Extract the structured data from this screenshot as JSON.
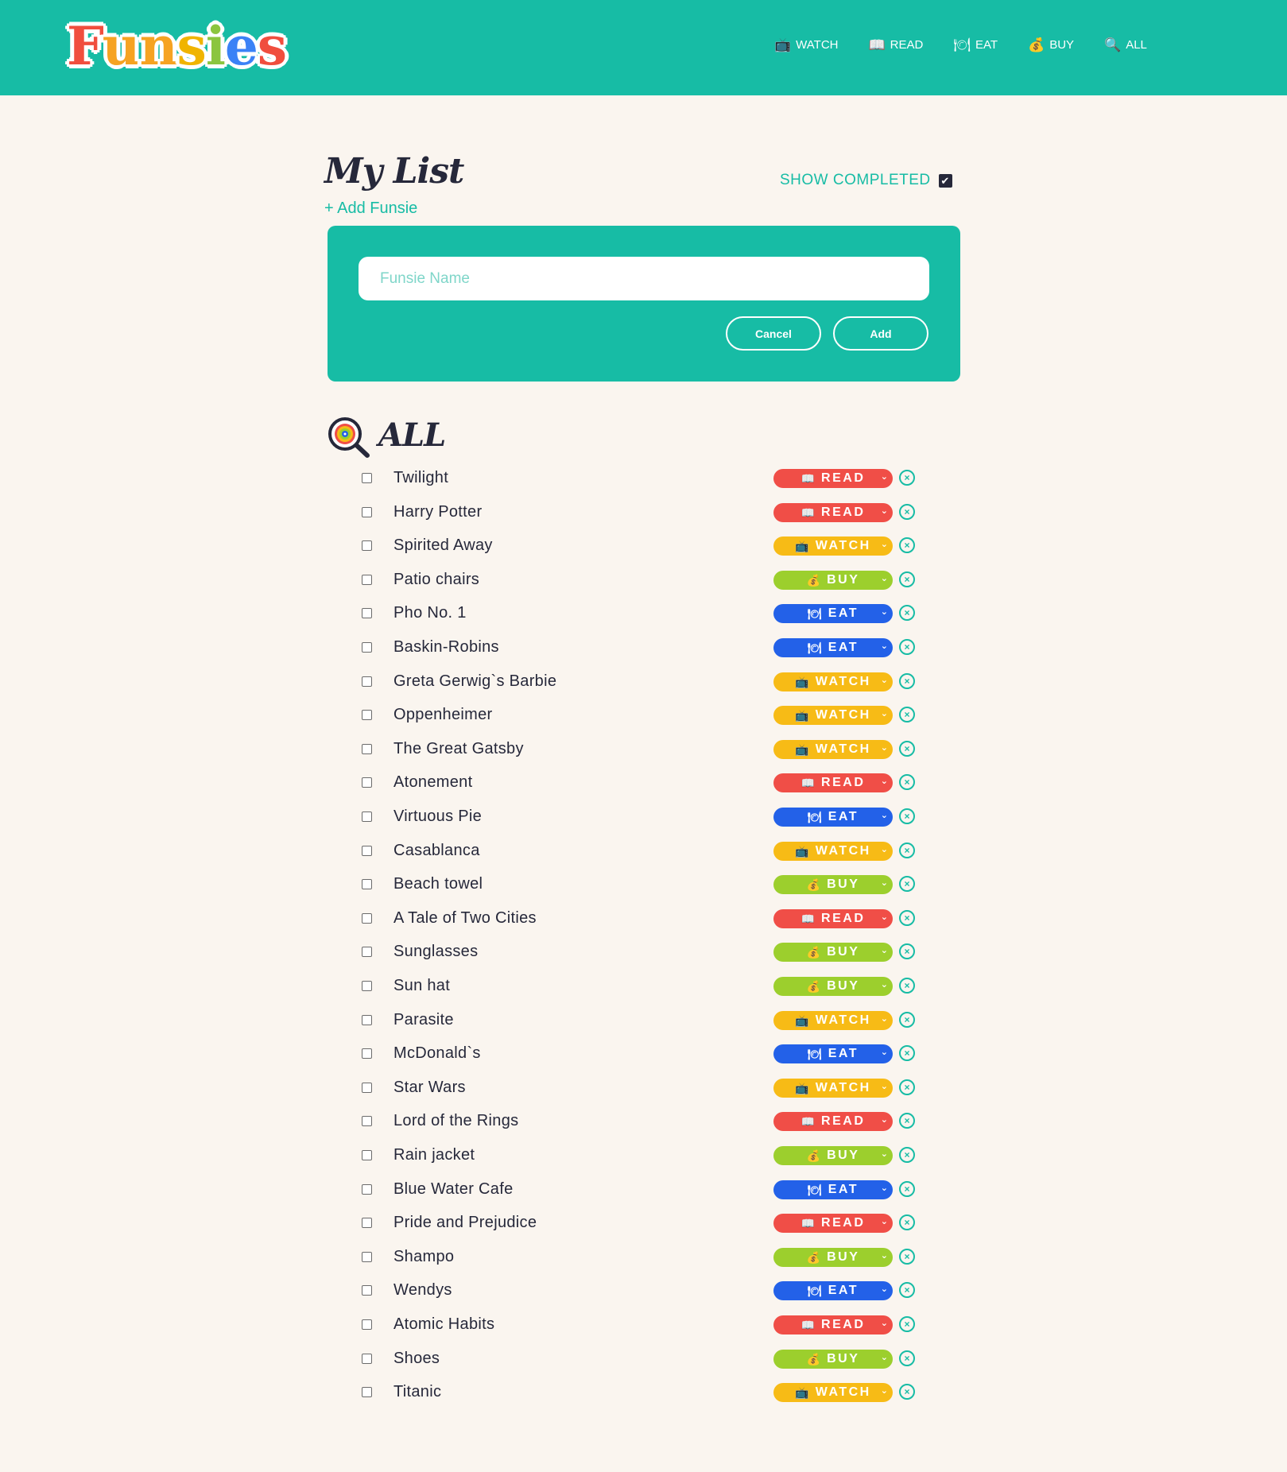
{
  "brand": {
    "logo_text": "Funsies"
  },
  "nav": [
    {
      "icon": "tv-icon",
      "glyph": "📺",
      "label": "WATCH"
    },
    {
      "icon": "book-icon",
      "glyph": "📖",
      "label": "READ"
    },
    {
      "icon": "plate-icon",
      "glyph": "🍽",
      "label": "EAT"
    },
    {
      "icon": "money-bag-icon",
      "glyph": "💰",
      "label": "BUY"
    },
    {
      "icon": "magnifier-icon",
      "glyph": "🔍",
      "label": "ALL"
    }
  ],
  "page": {
    "title": "My List",
    "show_completed_label": "SHOW COMPLETED",
    "show_completed_checked": true,
    "add_link": "+ Add Funsie"
  },
  "form": {
    "name_placeholder": "Funsie Name",
    "name_value": "",
    "cancel_label": "Cancel",
    "add_label": "Add"
  },
  "section": {
    "title": "ALL",
    "icon": "lollipop-magnifier-icon"
  },
  "categories": {
    "READ": {
      "glyph": "📖",
      "color": "#f04e47"
    },
    "WATCH": {
      "glyph": "📺",
      "color": "#f7bb16"
    },
    "BUY": {
      "glyph": "💰",
      "color": "#9ccf2d"
    },
    "EAT": {
      "glyph": "🍽",
      "color": "#2361e8"
    }
  },
  "items": [
    {
      "name": "Twilight",
      "category": "READ",
      "completed": false
    },
    {
      "name": "Harry Potter",
      "category": "READ",
      "completed": false
    },
    {
      "name": "Spirited Away",
      "category": "WATCH",
      "completed": false
    },
    {
      "name": "Patio chairs",
      "category": "BUY",
      "completed": false
    },
    {
      "name": "Pho No. 1",
      "category": "EAT",
      "completed": false
    },
    {
      "name": "Baskin-Robins",
      "category": "EAT",
      "completed": false
    },
    {
      "name": "Greta Gerwig`s Barbie",
      "category": "WATCH",
      "completed": false
    },
    {
      "name": "Oppenheimer",
      "category": "WATCH",
      "completed": false
    },
    {
      "name": "The Great Gatsby",
      "category": "WATCH",
      "completed": false
    },
    {
      "name": "Atonement",
      "category": "READ",
      "completed": false
    },
    {
      "name": "Virtuous Pie",
      "category": "EAT",
      "completed": false
    },
    {
      "name": "Casablanca",
      "category": "WATCH",
      "completed": false
    },
    {
      "name": "Beach towel",
      "category": "BUY",
      "completed": false
    },
    {
      "name": "A Tale of Two Cities",
      "category": "READ",
      "completed": false
    },
    {
      "name": "Sunglasses",
      "category": "BUY",
      "completed": false
    },
    {
      "name": "Sun hat",
      "category": "BUY",
      "completed": false
    },
    {
      "name": "Parasite",
      "category": "WATCH",
      "completed": false
    },
    {
      "name": "McDonald`s",
      "category": "EAT",
      "completed": false
    },
    {
      "name": "Star Wars",
      "category": "WATCH",
      "completed": false
    },
    {
      "name": "Lord of the Rings",
      "category": "READ",
      "completed": false
    },
    {
      "name": "Rain jacket",
      "category": "BUY",
      "completed": false
    },
    {
      "name": "Blue Water Cafe",
      "category": "EAT",
      "completed": false
    },
    {
      "name": "Pride and Prejudice",
      "category": "READ",
      "completed": false
    },
    {
      "name": "Shampo",
      "category": "BUY",
      "completed": false
    },
    {
      "name": "Wendys",
      "category": "EAT",
      "completed": false
    },
    {
      "name": "Atomic Habits",
      "category": "READ",
      "completed": false
    },
    {
      "name": "Shoes",
      "category": "BUY",
      "completed": false
    },
    {
      "name": "Titanic",
      "category": "WATCH",
      "completed": false
    }
  ]
}
